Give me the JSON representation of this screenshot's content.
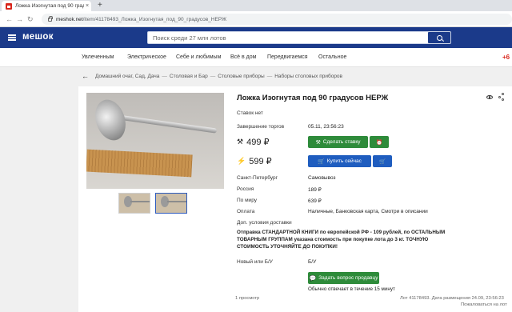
{
  "browser": {
    "tab_title": "Ложка Изогнутая под 90 градусо",
    "tab_close": "×",
    "new_tab": "+",
    "url_host": "meshok.net",
    "url_path": "/item/41178493_Ложка_Изогнутая_под_90_градусов_НЕРЖ"
  },
  "site": {
    "logo": "мешок",
    "search_placeholder": "Поиск среди 27 млн лотов"
  },
  "categories": [
    "Увлеченным",
    "Электрическое",
    "Себе и любимым",
    "Всё в дом",
    "Передвигаемся",
    "Остальное"
  ],
  "categories_more": "+6",
  "breadcrumb": [
    "Домашний очаг, Сад, Дача",
    "Столовая и Бар",
    "Столовые приборы",
    "Наборы столовых приборов"
  ],
  "breadcrumb_sep": "—",
  "item": {
    "title": "Ложка Изогнутая под 90 градусов НЕРЖ",
    "bids": "Ставок нет",
    "end_label": "Завершение торгов",
    "end_value": "05.11, 23:56:23",
    "bid_price": "499 ₽",
    "buy_price": "599 ₽",
    "bid_button": "Сделать ставку",
    "buy_button": "Купить сейчас",
    "city": "Санкт-Петербург",
    "pickup": "Самовывоз",
    "ship_russia_label": "Россия",
    "ship_russia_value": "189 ₽",
    "ship_world_label": "По миру",
    "ship_world_value": "639 ₽",
    "payment_label": "Оплата",
    "payment_value": "Наличные, Банковская карта, Смотри в описании",
    "delivery_terms_label": "Доп. условия доставки",
    "delivery_terms": "Отправка СТАНДАРТНОЙ КНИГИ по европейской РФ - 109 рублей, по ОСТАЛЬНЫМ ТОВАРНЫМ ГРУППАМ указана стоимость при покупке лота до 3 кг. ТОЧНУЮ СТОИМОСТЬ УТОЧНЯЙТЕ ДО ПОКУПКИ!",
    "condition_label": "Новый или Б/У",
    "condition_value": "Б/У",
    "ask_button": "Задать вопрос продавцу",
    "reply_note": "Обычно отвечает в течение 15 минут",
    "views": "1 просмотр",
    "lot_meta": "Лот 41178493. Дата размещения 24.09, 23:56:23",
    "complain": "Пожаловаться на лот"
  }
}
